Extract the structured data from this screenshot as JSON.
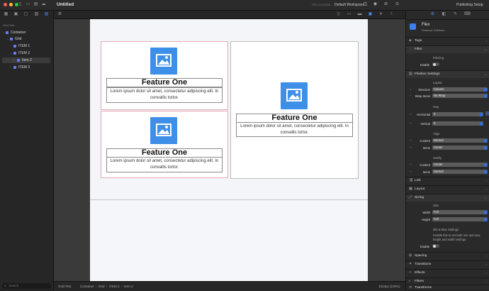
{
  "window": {
    "title": "Untitled",
    "license": "PRO LICENSE",
    "workspace": "Default Workspace",
    "publishing": "Publishing Setup"
  },
  "colors": {
    "accent": "#3d8fe8",
    "red": "#ff5f57",
    "yellow": "#febc2e",
    "green": "#28c840"
  },
  "sidebar": {
    "header": "Grid-Test",
    "items": [
      {
        "label": "Container"
      },
      {
        "label": "Grid"
      },
      {
        "label": "ITEM 1"
      },
      {
        "label": "ITEM 2"
      },
      {
        "label": "Item 2"
      },
      {
        "label": "ITEM 3"
      }
    ],
    "search_placeholder": "Search"
  },
  "canvas": {
    "cards": [
      {
        "title": "Feature One",
        "desc": "Lorem ipsum dolor sit amet, consectetur adipiscing elit. In convallis tortor."
      },
      {
        "title": "Feature One",
        "desc": "Lorem ipsum dolor sit amet, consectetur adipiscing elit. In convallis tortor."
      },
      {
        "title": "Feature One",
        "desc": "Lorem ipsum dolor sit amet, consectetur adipiscing elit. In convallis tortor."
      }
    ]
  },
  "status": {
    "project": "Grid-Test",
    "breadcrumb": "Container  ›  Grid  ›  ITEM 2  ›  Item 2",
    "zoom": "1024px (100%)"
  },
  "inspector": {
    "component": {
      "name": "Flex",
      "vendor": "Realmac Software"
    },
    "sections": {
      "tags": "Tags",
      "filter": "Filter",
      "flexbox": "Flexbox Settings",
      "link": "Link",
      "layout": "Layout",
      "sizing": "Sizing",
      "spacing": "Spacing",
      "transitions": "Transitions",
      "effects": "Effects",
      "filters": "Filters",
      "transforms": "Transforms"
    },
    "filtering": {
      "title": "Filtering",
      "enable_label": "Enable"
    },
    "layout": {
      "title": "Layout",
      "direction_label": "Direction",
      "direction_value": "Column",
      "wrap_label": "Wrap Items",
      "wrap_value": "No Wrap"
    },
    "gap": {
      "title": "Gap",
      "horizontal_label": "Horizontal",
      "horizontal_value": "3",
      "vertical_label": "Vertical",
      "vertical_value": "3"
    },
    "align": {
      "title": "Align",
      "content_label": "Content",
      "content_value": "Normal",
      "items_label": "Items",
      "items_value": "Center"
    },
    "justify": {
      "title": "Justify",
      "content_label": "Content",
      "content_value": "Center",
      "items_label": "Items",
      "items_value": "Normal"
    },
    "size": {
      "title": "Size",
      "width_label": "Width",
      "width_value": "Full",
      "height_label": "Height",
      "height_value": "Full"
    },
    "minmax": {
      "title": "Min & Max Settings",
      "desc": "Enable this to set both min and max height and width settings.",
      "enable_label": "Enable"
    }
  }
}
